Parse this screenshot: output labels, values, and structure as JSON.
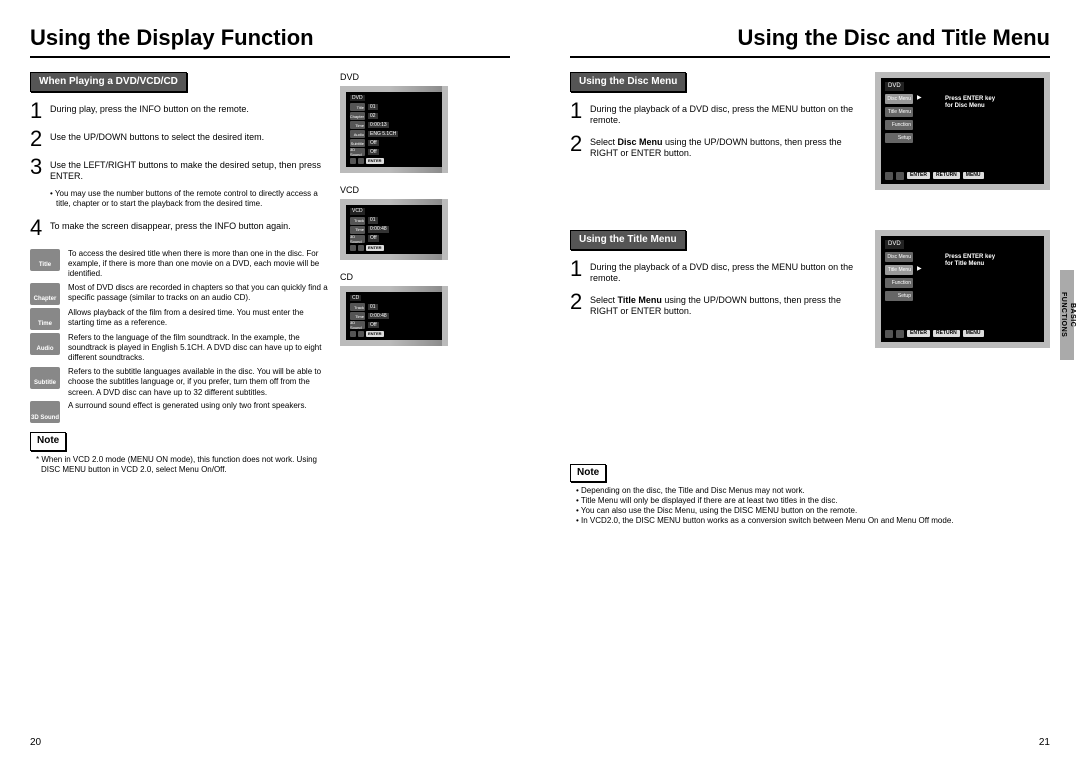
{
  "left": {
    "title": "Using the Display Function",
    "section_label": "When Playing a DVD/VCD/CD",
    "steps": [
      "During play, press the INFO button on the remote.",
      "Use the UP/DOWN buttons to select the desired item.",
      "Use the LEFT/RIGHT buttons to make the desired setup, then press ENTER.",
      "To make the screen disappear, press the INFO button again."
    ],
    "substep_after_3": "You may use the number buttons of the remote control to directly access a title, chapter or to start the playback from the desired time.",
    "icons": [
      {
        "label": "Title",
        "desc": "To access the desired title when there is more than one in the disc. For example, if there is more than one movie on a DVD, each movie will be identified."
      },
      {
        "label": "Chapter",
        "desc": "Most of DVD discs are recorded in chapters so that you can quickly find a specific passage (similar to tracks on an audio CD)."
      },
      {
        "label": "Time",
        "desc": "Allows playback of the film from a desired time. You must enter the starting time as a reference."
      },
      {
        "label": "Audio",
        "desc": "Refers to the language of the film soundtrack. In the example, the soundtrack is played in English 5.1CH. A DVD disc can have up to eight different soundtracks."
      },
      {
        "label": "Subtitle",
        "desc": "Refers to the subtitle languages available in the disc. You will be able to choose the subtitles language or, if you prefer, turn them off from the screen. A DVD disc can have up to 32 different subtitles."
      },
      {
        "label": "3D Sound",
        "desc": "A surround sound effect is generated using only two front speakers."
      }
    ],
    "note_label": "Note",
    "note_text": "When in VCD 2.0 mode (MENU ON mode), this function does not work. Using DISC MENU button in VCD 2.0, select Menu On/Off.",
    "thumbs": {
      "dvd": {
        "caption": "DVD",
        "head": "DVD",
        "rows": [
          {
            "icon": "Title",
            "val": "01"
          },
          {
            "icon": "Chapter",
            "val": "02"
          },
          {
            "icon": "Time",
            "val": "0:00:13"
          },
          {
            "icon": "Audio",
            "val": "ENG 5.1CH"
          },
          {
            "icon": "Subtitle",
            "val": "Off"
          },
          {
            "icon": "3D Sound",
            "val": "Off"
          }
        ],
        "btn": "ENTER"
      },
      "vcd": {
        "caption": "VCD",
        "head": "VCD",
        "rows": [
          {
            "icon": "Track",
            "val": "01"
          },
          {
            "icon": "Time",
            "val": "0:00:48"
          },
          {
            "icon": "3D Sound",
            "val": "Off"
          }
        ],
        "btn": "ENTER"
      },
      "cd": {
        "caption": "CD",
        "head": "CD",
        "rows": [
          {
            "icon": "Track",
            "val": "01"
          },
          {
            "icon": "Time",
            "val": "0:00:48"
          },
          {
            "icon": "3D Sound",
            "val": "Off"
          }
        ],
        "btn": "ENTER"
      }
    },
    "page_num": "20"
  },
  "right": {
    "title": "Using the Disc and Title Menu",
    "section_disc": {
      "label": "Using the Disc Menu",
      "steps": [
        "During the playback of a DVD disc, press the MENU button on the remote.",
        "Select Disc Menu using the UP/DOWN buttons, then press the RIGHT or ENTER button."
      ],
      "bold_in_step2": "Disc Menu",
      "osd": {
        "head": "DVD",
        "items": [
          "Disc Menu",
          "Title Menu",
          "Function",
          "Setup"
        ],
        "selected": 0,
        "msg_line1": "Press ENTER key",
        "msg_line2": "for Disc Menu",
        "buttons": [
          "ENTER",
          "RETURN",
          "MENU"
        ]
      }
    },
    "section_title": {
      "label": "Using the Title Menu",
      "steps": [
        "During the playback of a DVD disc, press the MENU button on the remote.",
        "Select Title Menu using the UP/DOWN buttons, then press the RIGHT or ENTER button."
      ],
      "bold_in_step2": "Title Menu",
      "osd": {
        "head": "DVD",
        "items": [
          "Disc Menu",
          "Title Menu",
          "Function",
          "Setup"
        ],
        "selected": 1,
        "msg_line1": "Press ENTER key",
        "msg_line2": "for Title Menu",
        "buttons": [
          "ENTER",
          "RETURN",
          "MENU"
        ]
      }
    },
    "note_label": "Note",
    "notes": [
      "Depending on the disc, the Title and Disc Menus may not work.",
      "Title Menu will only be displayed if there are at least two titles in the disc.",
      "You can also use the Disc Menu, using the DISC MENU button on the remote.",
      "In VCD2.0, the DISC MENU button works as a conversion switch between Menu On and Menu Off mode."
    ],
    "side_tab_line1": "BASIC",
    "side_tab_line2": "FUNCTIONS",
    "page_num": "21"
  }
}
